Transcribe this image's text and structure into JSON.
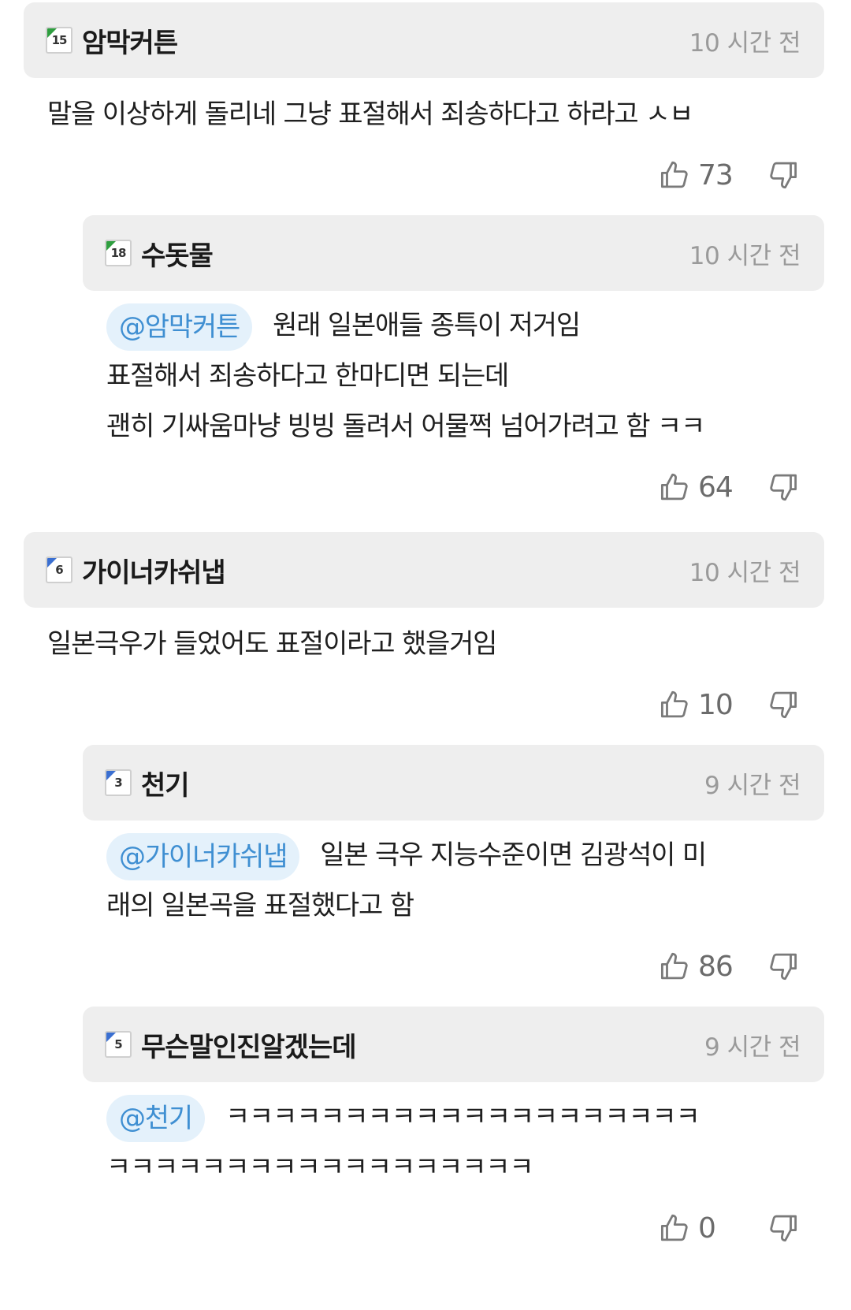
{
  "comments": [
    {
      "level": "15",
      "username": "암막커튼",
      "time": "10 시간 전",
      "mention": "",
      "lines": [
        "말을 이상하게 돌리네 그냥 표절해서 죄송하다고 하라고 ㅅㅂ"
      ],
      "likes": "73"
    },
    {
      "level": "18",
      "username": "수돗물",
      "time": "10 시간 전",
      "mention": "@암막커튼",
      "lines": [
        "원래 일본애들 종특이 저거임",
        "표절해서 죄송하다고 한마디면 되는데",
        "괜히 기싸움마냥 빙빙 돌려서 어물쩍 넘어가려고 함 ㅋㅋ"
      ],
      "likes": "64"
    },
    {
      "level": "6",
      "username": "가이너카쉬냅",
      "time": "10 시간 전",
      "mention": "",
      "lines": [
        "일본극우가 들었어도 표절이라고 했을거임"
      ],
      "likes": "10"
    },
    {
      "level": "3",
      "username": "천기",
      "time": "9 시간 전",
      "mention": "@가이너카쉬냅",
      "lines": [
        "일본 극우 지능수준이면 김광석이 미",
        "래의 일본곡을 표절했다고 함"
      ],
      "likes": "86"
    },
    {
      "level": "5",
      "username": "무슨말인진알겠는데",
      "time": "9 시간 전",
      "mention": "@천기",
      "lines": [
        "ㅋㅋㅋㅋㅋㅋㅋㅋㅋㅋㅋㅋㅋㅋㅋㅋㅋㅋㅋㅋ",
        "ㅋㅋㅋㅋㅋㅋㅋㅋㅋㅋㅋㅋㅋㅋㅋㅋㅋㅋ"
      ],
      "likes": "0"
    }
  ],
  "colors": {
    "header_bg": "#eeeeee",
    "mention_bg": "#e4f1fb",
    "mention_text": "#3f8fd2",
    "badge_green": "#2e9e3f",
    "badge_blue": "#3a6fd1"
  },
  "icons": {
    "like": "thumbs-up-icon",
    "dislike": "thumbs-down-icon"
  }
}
